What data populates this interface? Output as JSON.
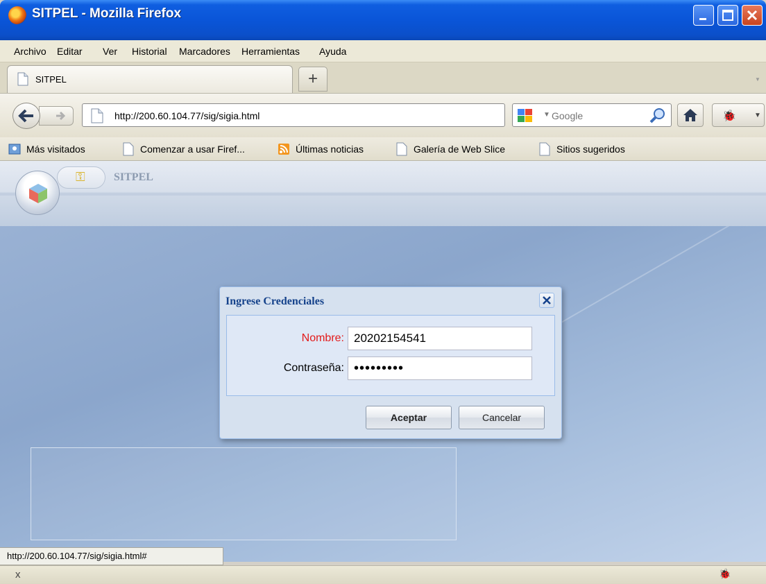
{
  "window": {
    "title": "SITPEL - Mozilla Firefox"
  },
  "menu": [
    "Archivo",
    "Editar",
    "Ver",
    "Historial",
    "Marcadores",
    "Herramientas",
    "Ayuda"
  ],
  "tab": {
    "label": "SITPEL",
    "new_tab_symbol": "+"
  },
  "nav": {
    "url": "http://200.60.104.77/sig/sigia.html",
    "search_placeholder": "Google"
  },
  "bookmarks": [
    "Más visitados",
    "Comenzar a usar Firef...",
    "Últimas noticias",
    "Galería de Web Slice",
    "Sitios sugeridos"
  ],
  "app": {
    "tab_label": "SITPEL"
  },
  "dialog": {
    "title": "Ingrese Credenciales",
    "nombre_label": "Nombre:",
    "nombre_value": "20202154541",
    "password_label": "Contraseña:",
    "password_value": "•••••••••",
    "accept_label": "Aceptar",
    "cancel_label": "Cancelar"
  },
  "status": {
    "link_url": "http://200.60.104.77/sig/sigia.html#",
    "stop_symbol": "x"
  },
  "colors": {
    "titlebar": "#0a55d8",
    "required_label": "#e31a1a",
    "dialog_title": "#15428b",
    "dialog_bg": "#d6e1ef"
  }
}
